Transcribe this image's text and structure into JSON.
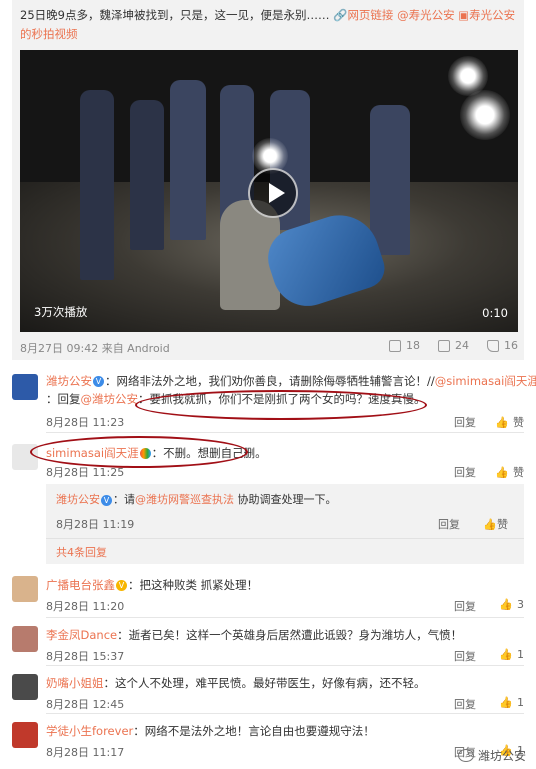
{
  "post": {
    "text": "25日晚9点多，魏泽坤被找到，只是，这一见，便是永别……",
    "link1": "网页链接",
    "link2": "寿光公安",
    "link3": "寿光公安的秒拍视频",
    "video_views": "3万次播放",
    "video_duration": "0:10",
    "time": "8月27日 09:42 来自 Android",
    "forward": "18",
    "comments": "24",
    "likes": "16"
  },
  "comments": [
    {
      "name": "潍坊公安",
      "text_a": "：网络非法外之地，我们劝你善良，请删除侮辱牺牲辅警言论！//",
      "mention": "@simimasai阎天涯",
      "text_b": "：回复",
      "mention2": "@潍坊公安",
      "text_c": "：要抓我就抓，你们不是刚抓了两个女的吗？速度真慢。",
      "time": "8月28日 11:23",
      "reply": "回复",
      "like": "赞"
    },
    {
      "name": "simimasai阎天涯",
      "text": "：不删。想删自己删。",
      "time": "8月28日 11:25",
      "reply": "回复",
      "like": "赞"
    }
  ],
  "subreply": {
    "name": "潍坊公安",
    "text_a": "：请",
    "mention": "@潍坊网警巡查执法",
    "text_b": " 协助调查处理一下。",
    "time": "8月28日 11:19",
    "reply": "回复",
    "like": "赞",
    "more": "共4条回复"
  },
  "comments2": [
    {
      "name": "广播电台张鑫",
      "text": "：把这种败类 抓紧处理！",
      "time": "8月28日 11:20",
      "reply": "回复",
      "like": "3"
    },
    {
      "name": "李金凤Dance",
      "text": "：逝者已矣！这样一个英雄身后居然遭此诋毁？身为潍坊人，气愤！",
      "time": "8月28日 15:37",
      "reply": "回复",
      "like": "1"
    },
    {
      "name": "奶嘴小姐姐",
      "text": "：这个人不处理，难平民愤。最好带医生，好像有病，还不轻。",
      "time": "8月28日 12:45",
      "reply": "回复",
      "like": "1"
    },
    {
      "name": "学徒小生forever",
      "text": "：网络不是法外之地！言论自由也要遵规守法！",
      "time": "8月28日 11:17",
      "reply": "回复",
      "like": "1"
    }
  ],
  "watermark": "潍坊公安",
  "colors": {
    "accent": "#eb7350",
    "circle": "#a10f16"
  }
}
